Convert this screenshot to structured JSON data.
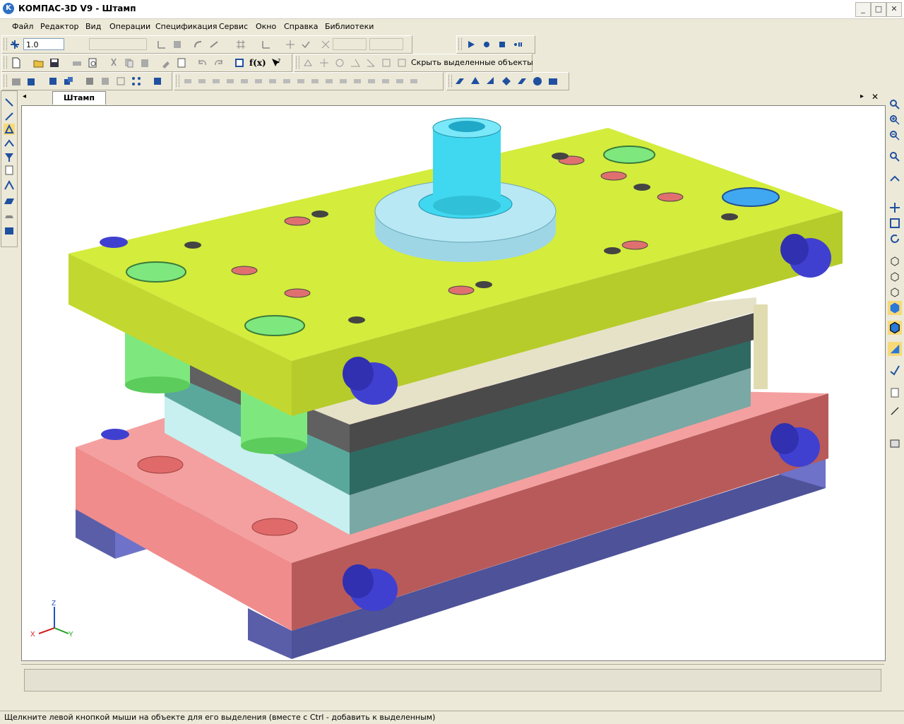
{
  "window": {
    "title": "КОМПАС-3D V9 - Штамп",
    "buttons": {
      "minimize": "_",
      "maximize": "□",
      "close": "✕"
    }
  },
  "menu": [
    "Файл",
    "Редактор",
    "Вид",
    "Операции",
    "Спецификация",
    "Сервис",
    "Окно",
    "Справка",
    "Библиотеки"
  ],
  "toolbar": {
    "scale_value": "1.0",
    "hide_selected_label": "Скрыть выделенные объекты",
    "formula_label": "f(x)"
  },
  "document": {
    "tab_label": "Штамп"
  },
  "axes": {
    "x": "X",
    "y": "Y",
    "z": "Z"
  },
  "status": {
    "hint": "Щелкните левой кнопкой мыши на объекте для его выделения (вместе с Ctrl - добавить к выделенным)"
  },
  "colors": {
    "top_plate": "#d4ec3c",
    "bottom_plate": "#f08c8c",
    "shank": "#40d8f0",
    "flange": "#b8e8f4",
    "guide_post": "#7ee87e",
    "bolt": "#4040d0",
    "mid_block": "#3a9a8c",
    "base_feet": "#6e72c8"
  }
}
